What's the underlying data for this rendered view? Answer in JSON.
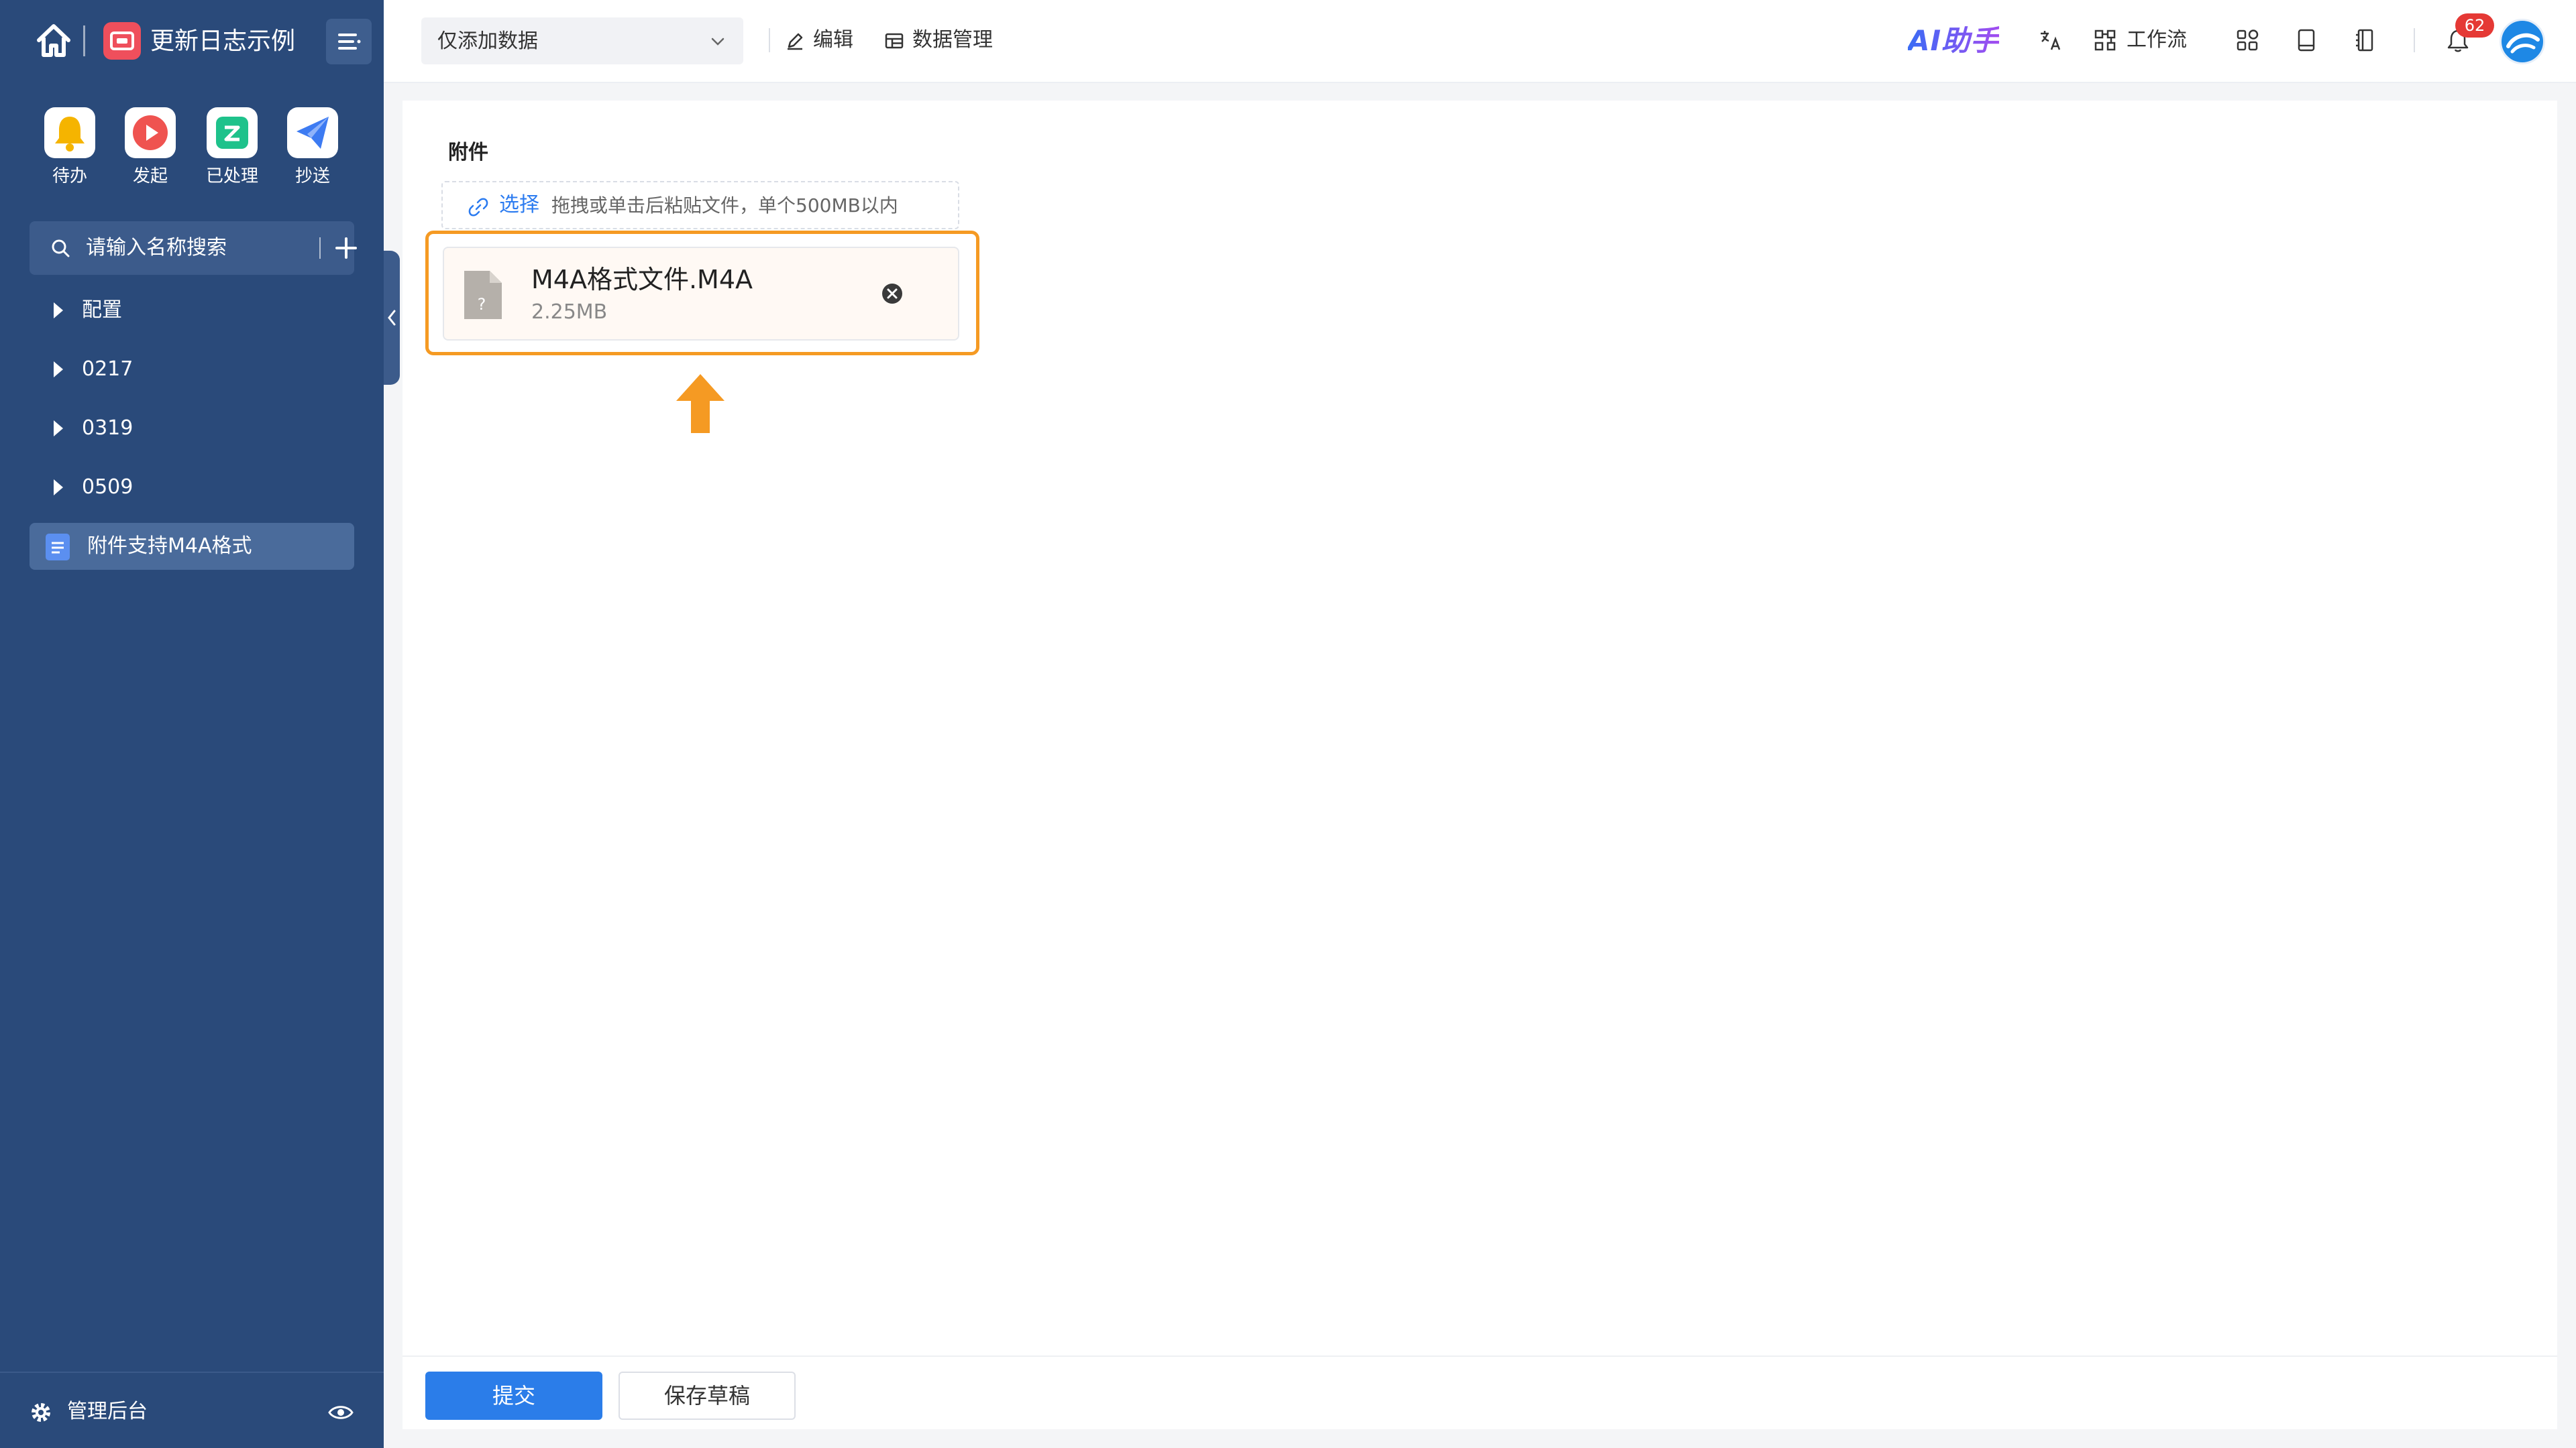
{
  "sidebar": {
    "app_title": "更新日志示例",
    "quick_actions": [
      {
        "label": "待办",
        "icon": "bell-icon",
        "color": "#f5b400"
      },
      {
        "label": "发起",
        "icon": "play-icon",
        "color": "#ef5350"
      },
      {
        "label": "已处理",
        "icon": "done-icon",
        "color": "#1ec28b"
      },
      {
        "label": "抄送",
        "icon": "send-icon",
        "color": "#3d7bf2"
      }
    ],
    "search_placeholder": "请输入名称搜索",
    "tree": [
      {
        "label": "配置"
      },
      {
        "label": "0217"
      },
      {
        "label": "0319"
      },
      {
        "label": "0509"
      },
      {
        "label": "附件支持M4A格式",
        "active": true
      }
    ],
    "admin_label": "管理后台"
  },
  "topbar": {
    "view_select": "仅添加数据",
    "edit_label": "编辑",
    "data_manage_label": "数据管理",
    "ai_label": "AI助手",
    "workflow_label": "工作流",
    "notification_count": "62"
  },
  "form": {
    "attachment_label": "附件",
    "choose_label": "选择",
    "upload_hint": "拖拽或单击后粘贴文件，单个500MB以内",
    "file": {
      "name": "M4A格式文件.M4A",
      "size": "2.25MB"
    },
    "submit_label": "提交",
    "draft_label": "保存草稿"
  },
  "colors": {
    "sidebar_bg": "#2a4a7a",
    "accent": "#2b7de9",
    "highlight": "#f59a23",
    "ai_gradient": [
      "#3a6cf5",
      "#a24cf0"
    ]
  }
}
